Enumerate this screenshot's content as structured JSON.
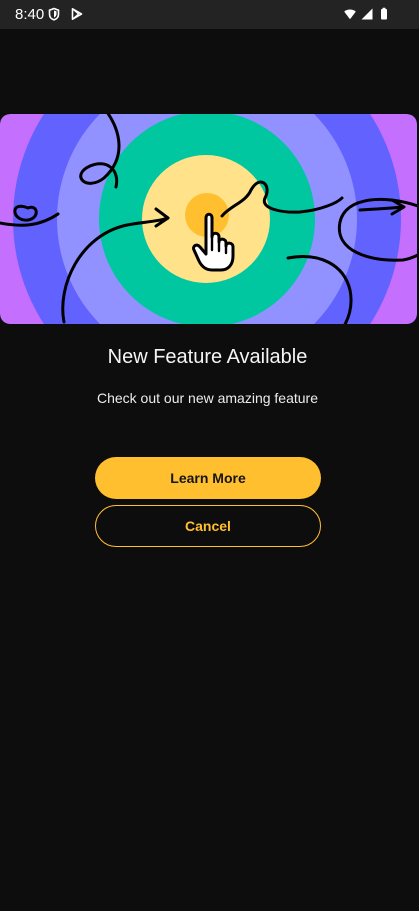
{
  "status_bar": {
    "time": "8:40",
    "left_icons": [
      "shield-icon",
      "play-store-icon"
    ],
    "right_icons": [
      "wifi-icon",
      "signal-icon",
      "battery-icon"
    ]
  },
  "hero": {
    "illustration": "tap-target-illustration",
    "colors": {
      "outer": "#c56fff",
      "ring_1": "#6262ff",
      "ring_2": "#9191ff",
      "ring_3": "#00c7a0",
      "center": "#ffe28a",
      "dot": "#ffbf2f"
    }
  },
  "content": {
    "title": "New Feature Available",
    "subtitle": "Check out our new amazing feature",
    "primary_button": "Learn More",
    "secondary_button": "Cancel"
  },
  "theme": {
    "background": "#0d0d0d",
    "accent": "#ffbf2f",
    "status_bar": "#232323"
  }
}
